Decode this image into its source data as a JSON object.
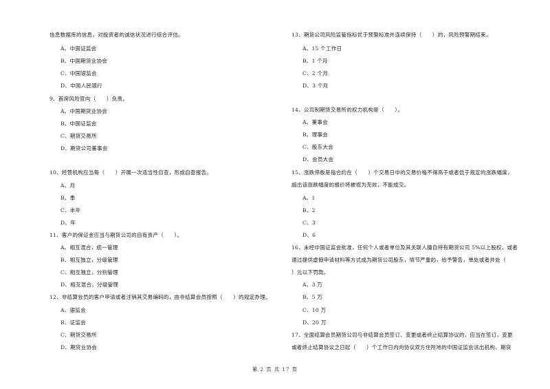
{
  "left": {
    "q8_tail": "信息数据库的信息，对投资者的诚信状况进行综合评估。",
    "q8_options": [
      "A、中国证监会",
      "B、中国期货业协会",
      "C、中国银监会",
      "D、中国人民银行"
    ],
    "q9": "9、首席风险官向（　　）负责。",
    "q9_options": [
      "A、中国期货业协会",
      "B、中国证监会",
      "C、期货交易所",
      "D、期货公司董事会"
    ],
    "q10": "10、经营机构应当每（　　）开展一次适当性自查，形成自查报告。",
    "q10_options": [
      "A、月",
      "B、季",
      "C、半年",
      "D、年"
    ],
    "q11": "11、客户的保证金应当与期货公司的自有资产（　　）。",
    "q11_options": [
      "A、相互混合，统一管理",
      "B、相互独立，分级管理",
      "C、相互独立，分别管理",
      "D、相互混合，分级管理"
    ],
    "q12": "12、非结算会员的客户申请或者注销其交易编码的，由非结算会员按照（　　）的规定办理。",
    "q12_options": [
      "A、银监会",
      "B、证监会",
      "C、期货交易所",
      "D、期货业协会"
    ]
  },
  "right": {
    "q13": "13、期货公司风险监管指标优于预警标准并连续保持（　　）的，风险预警期结束。",
    "q13_options": [
      "A、15 个工作日",
      "B、1 个月",
      "C、2 个月",
      "D、3 个月"
    ],
    "q14": "14、公司制期货交易所的权力机构是（　　）。",
    "q14_options": [
      "A、董事会",
      "B、理事会",
      "C、股东大会",
      "D、会员大会"
    ],
    "q15_line1": "15、涨跌停板是指合约在（　　）个交易日中的交易价格不得高于或者低于规定的涨跌幅度，",
    "q15_line2": "超出该涨跌幅度的报价将被视为无效，不能成交。",
    "q15_options": [
      "A、1",
      "B、2",
      "C、3",
      "D、6"
    ],
    "q16_line1": "16、未经中国证监会批准，任何个人或者单位及其关联人擅自持有期货公司 5%以上股权，或者",
    "q16_line2": "通过提供虚假申请材料等方式成为期货公司股东，情节严重的，给予警告，单处或者并处（",
    "q16_line3": "）元以下罚款。",
    "q16_options": [
      "A、3 万",
      "B、5 万",
      "C、10 万",
      "D、20 万"
    ],
    "q17_line1": "17、全面结算会员期货公司与非结算会员签订、变更或者终止结算协议的，应当在签订，变更",
    "q17_line2": "或者终止结算协议之日起（　　）个工作日内向协议双方住所地的中国证监会派出机构、期货"
  },
  "footer": "第 2 页 共 17 页"
}
